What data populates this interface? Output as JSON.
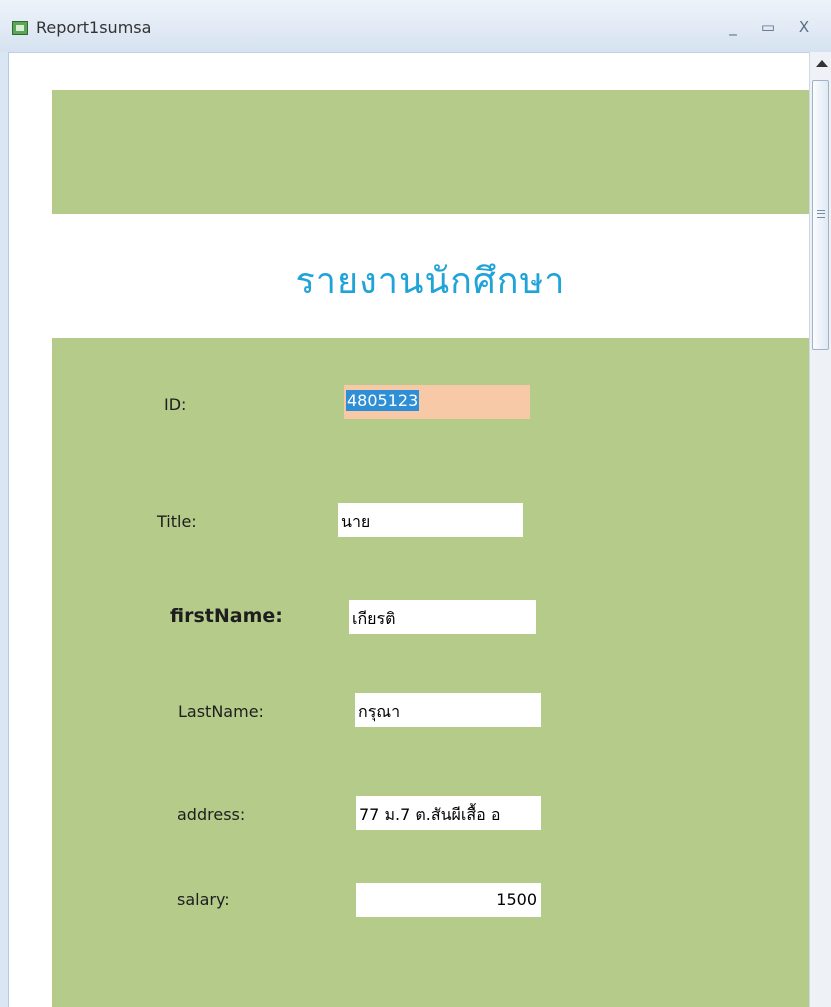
{
  "window": {
    "title": "Report1sumsa",
    "minimize": "_",
    "maximize": "▭",
    "close": "X"
  },
  "report": {
    "title": "รายงานนักศึกษา",
    "fields": {
      "id": {
        "label": "ID:",
        "value": "4805123"
      },
      "title": {
        "label": "Title:",
        "value": "นาย"
      },
      "first_name": {
        "label": "firstName:",
        "value": "เกียรติ"
      },
      "last_name": {
        "label": "LastName:",
        "value": "กรุณา"
      },
      "address": {
        "label": "address:",
        "value": "77 ม.7 ต.สันผีเสื้อ อ"
      },
      "salary": {
        "label": "salary:",
        "value": "1500"
      }
    }
  },
  "colors": {
    "band": "#b4cb8a",
    "title": "#1fa3d8",
    "id_field": "#f7c9a6",
    "selection": "#2f8fd6"
  }
}
